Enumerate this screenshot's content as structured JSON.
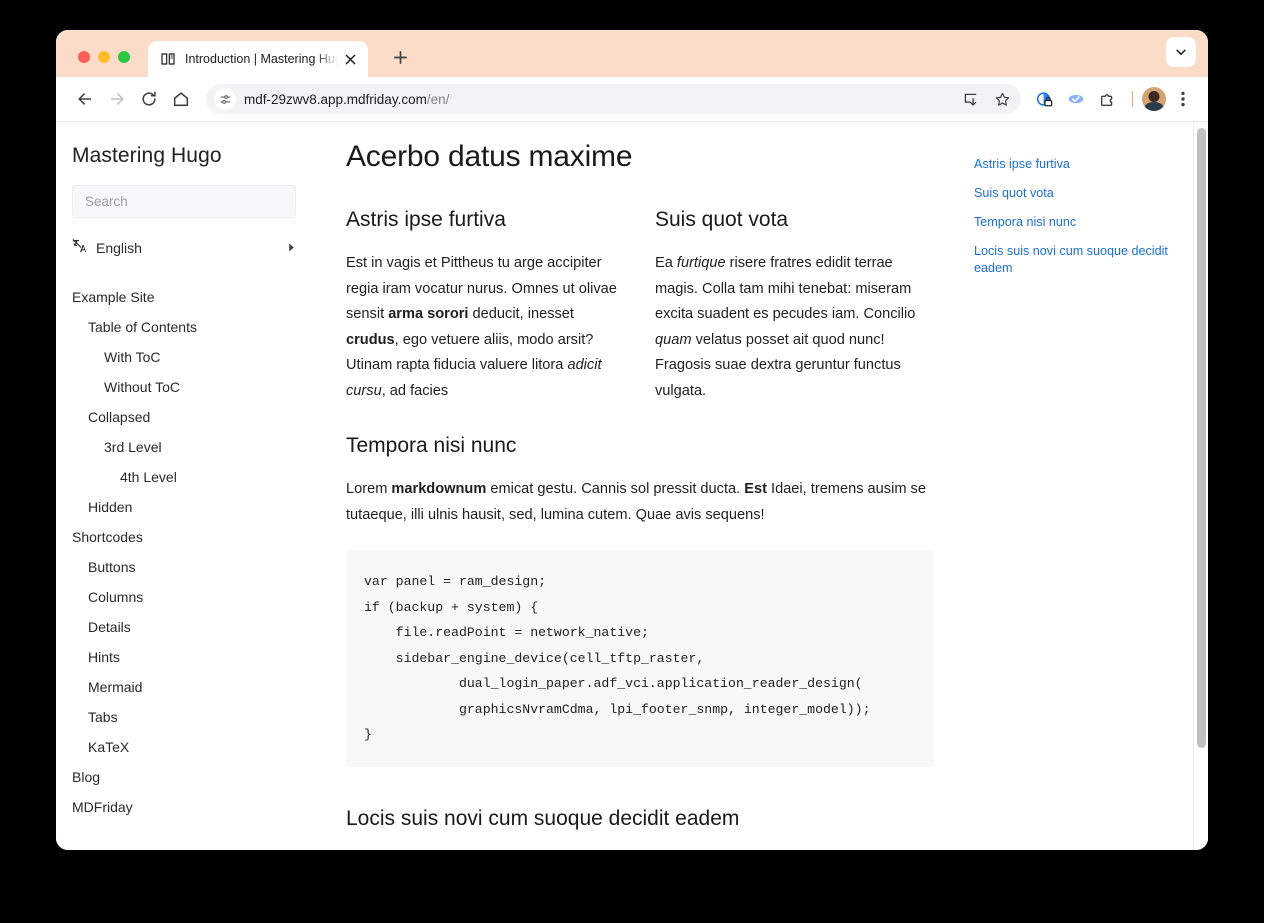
{
  "browser": {
    "tab": {
      "title": "Introduction | Mastering Hugo",
      "favicon_icon": "book-icon",
      "close_icon": "close-icon"
    },
    "new_tab_icon": "plus-icon",
    "tab_list_icon": "chevron-down-icon",
    "traffic_lights": [
      "close-red",
      "minimize-yellow",
      "maximize-green"
    ],
    "toolbar": {
      "back_icon": "arrow-left-icon",
      "forward_icon": "arrow-right-icon",
      "reload_icon": "reload-icon",
      "home_icon": "home-icon",
      "site_info_icon": "tune-icon",
      "url_main": "mdf-29zwv8.app.mdfriday.com",
      "url_path": "/en/",
      "install_icon": "install-app-icon",
      "bookmark_icon": "star-icon",
      "privacy_icon": "privacy-lock-icon",
      "save_icon": "save-cloud-icon",
      "extensions_icon": "extensions-puzzle-icon",
      "profile_icon": "avatar-icon",
      "menu_icon": "three-dot-menu-icon"
    },
    "accent_color": "#fadcc8"
  },
  "sidebar": {
    "site_title": "Mastering Hugo",
    "search": {
      "placeholder": "Search",
      "value": ""
    },
    "language": {
      "icon": "translate-icon",
      "label": "English",
      "arrow_icon": "chevron-right-icon"
    },
    "nav": [
      {
        "label": "Example Site",
        "level": 0
      },
      {
        "label": "Table of Contents",
        "level": 1
      },
      {
        "label": "With ToC",
        "level": 2
      },
      {
        "label": "Without ToC",
        "level": 2
      },
      {
        "label": "Collapsed",
        "level": 1
      },
      {
        "label": "3rd Level",
        "level": 2
      },
      {
        "label": "4th Level",
        "level": 3
      },
      {
        "label": "Hidden",
        "level": 1
      },
      {
        "label": "Shortcodes",
        "level": 0
      },
      {
        "label": "Buttons",
        "level": 1
      },
      {
        "label": "Columns",
        "level": 1
      },
      {
        "label": "Details",
        "level": 1
      },
      {
        "label": "Hints",
        "level": 1
      },
      {
        "label": "Mermaid",
        "level": 1
      },
      {
        "label": "Tabs",
        "level": 1
      },
      {
        "label": "KaTeX",
        "level": 1
      },
      {
        "label": "Blog",
        "level": 0
      },
      {
        "label": "MDFriday",
        "level": 0
      }
    ]
  },
  "main": {
    "page_title": "Acerbo datus maxime",
    "columns": [
      {
        "heading": "Astris ipse furtiva",
        "paragraph_parts": [
          {
            "text": "Est in vagis et Pittheus tu arge accipiter regia iram vocatur nurus. Omnes ut olivae sensit ",
            "style": "normal"
          },
          {
            "text": "arma sorori",
            "style": "bold"
          },
          {
            "text": " deducit, inesset ",
            "style": "normal"
          },
          {
            "text": "crudus",
            "style": "bold"
          },
          {
            "text": ", ego vetuere aliis, modo arsit? Utinam rapta fiducia valuere litora ",
            "style": "normal"
          },
          {
            "text": "adicit cursu",
            "style": "italic"
          },
          {
            "text": ", ad facies",
            "style": "normal"
          }
        ]
      },
      {
        "heading": "Suis quot vota",
        "paragraph_parts": [
          {
            "text": "Ea ",
            "style": "normal"
          },
          {
            "text": "furtique",
            "style": "italic"
          },
          {
            "text": " risere fratres edidit terrae magis. Colla tam mihi tenebat: miseram excita suadent es pecudes iam. Concilio ",
            "style": "normal"
          },
          {
            "text": "quam",
            "style": "italic"
          },
          {
            "text": " velatus posset ait quod nunc! Fragosis suae dextra geruntur functus vulgata.",
            "style": "normal"
          }
        ]
      }
    ],
    "section": {
      "heading": "Tempora nisi nunc",
      "paragraph_parts": [
        {
          "text": "Lorem ",
          "style": "normal"
        },
        {
          "text": "markdownum",
          "style": "bold"
        },
        {
          "text": " emicat gestu. Cannis sol pressit ducta. ",
          "style": "normal"
        },
        {
          "text": "Est",
          "style": "bold"
        },
        {
          "text": " Idaei, tremens ausim se tutaeque, illi ulnis hausit, sed, lumina cutem. Quae avis sequens!",
          "style": "normal"
        }
      ],
      "code": "var panel = ram_design;\nif (backup + system) {\n    file.readPoint = network_native;\n    sidebar_engine_device(cell_tftp_raster,\n            dual_login_paper.adf_vci.application_reader_design(\n            graphicsNvramCdma, lpi_footer_snmp, integer_model));\n}"
    },
    "bottom_heading": "Locis suis novi cum suoque decidit eadem"
  },
  "toc": {
    "links": [
      "Astris ipse furtiva",
      "Suis quot vota",
      "Tempora nisi nunc",
      "Locis suis novi cum suoque decidit eadem"
    ],
    "link_color": "#1a6fd4"
  }
}
